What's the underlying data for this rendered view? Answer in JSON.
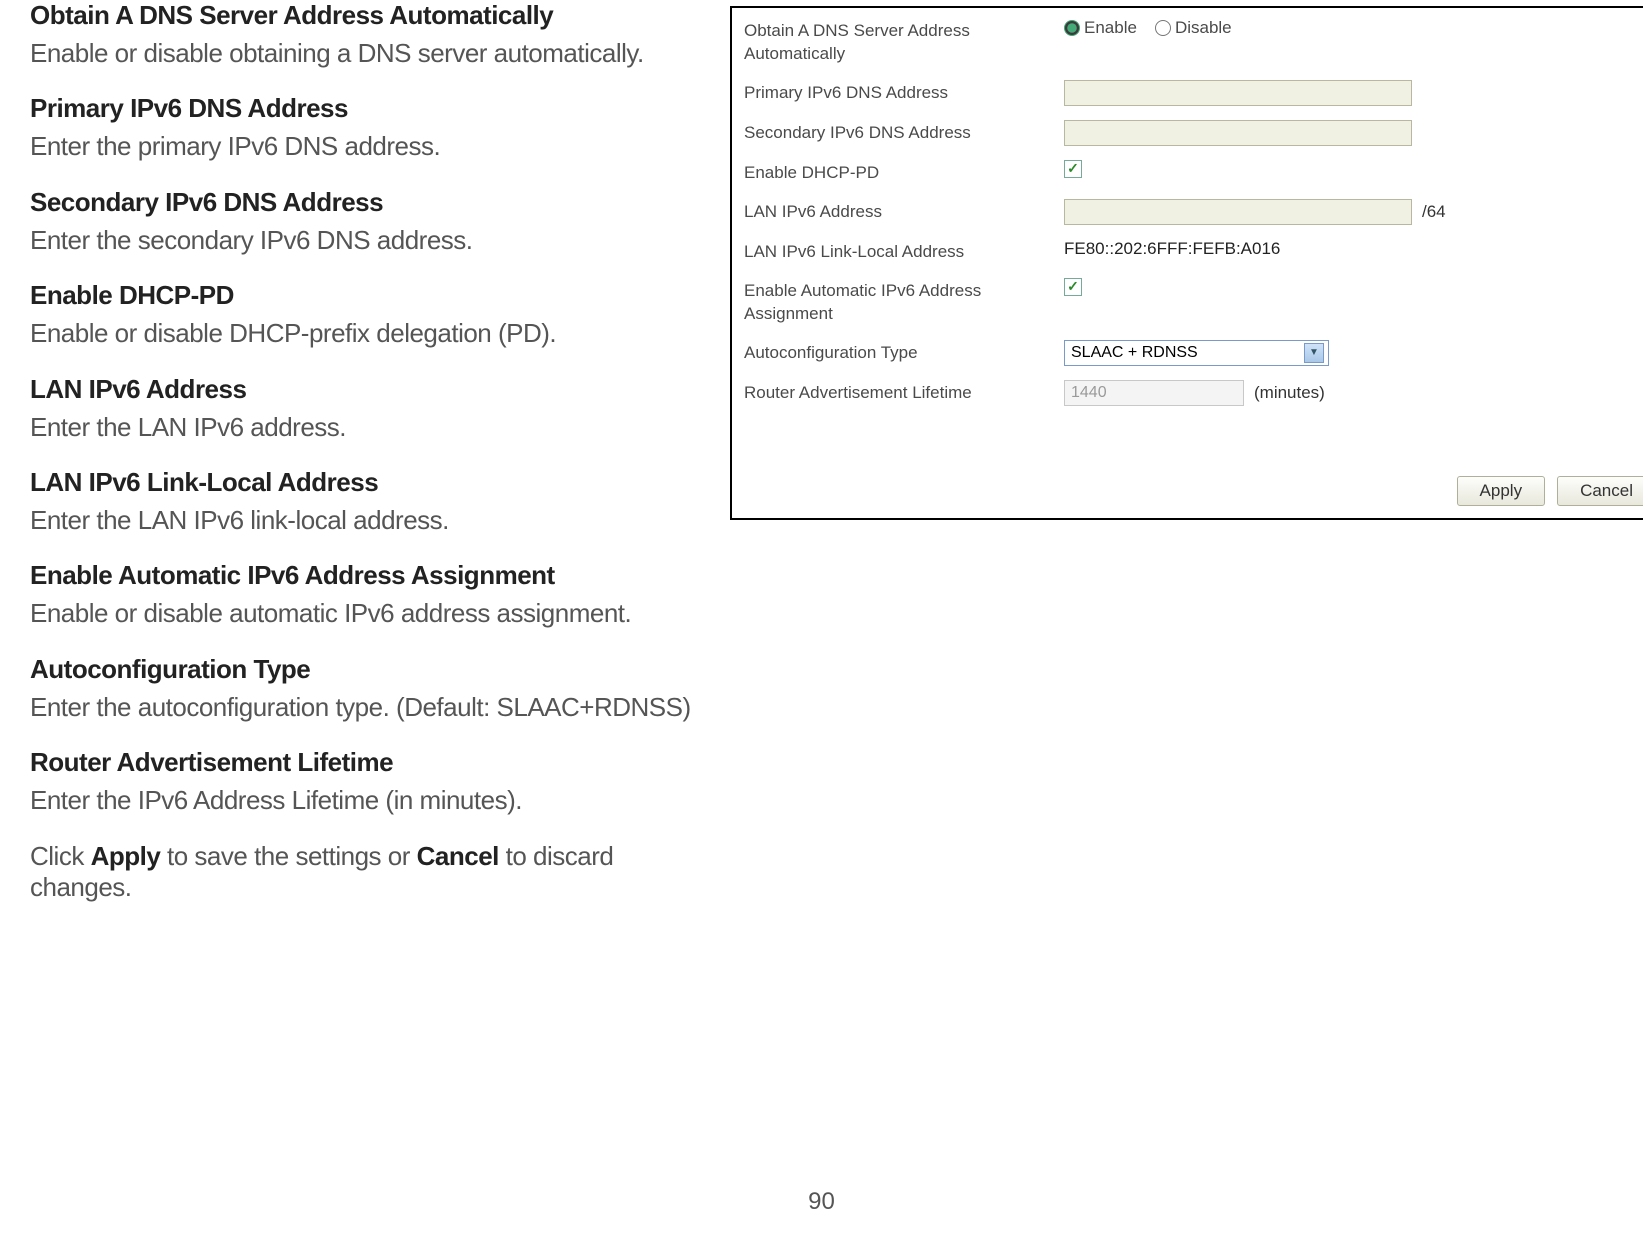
{
  "doc": {
    "items": [
      {
        "heading": "Obtain A DNS Server Address Automatically",
        "desc": "Enable or disable obtaining a DNS server automatically."
      },
      {
        "heading": "Primary IPv6 DNS Address",
        "desc": "Enter the primary IPv6 DNS address."
      },
      {
        "heading": "Secondary IPv6 DNS Address",
        "desc": "Enter the secondary IPv6 DNS address."
      },
      {
        "heading": "Enable DHCP-PD",
        "desc": "Enable or disable DHCP-prefix delegation (PD)."
      },
      {
        "heading": "LAN IPv6 Address",
        "desc": "Enter the LAN IPv6 address."
      },
      {
        "heading": "LAN IPv6 Link-Local Address",
        "desc": "Enter the LAN IPv6 link-local address."
      },
      {
        "heading": "Enable Automatic IPv6 Address Assignment",
        "desc": "Enable or disable automatic IPv6 address assignment."
      },
      {
        "heading": "Autoconfiguration Type",
        "desc": "Enter the autoconfiguration type. (Default: SLAAC+RDNSS)"
      },
      {
        "heading": "Router Advertisement Lifetime",
        "desc": "Enter the IPv6 Address Lifetime (in minutes)."
      }
    ],
    "final_pre": "Click ",
    "final_b1": "Apply",
    "final_mid": " to save the settings or ",
    "final_b2": "Cancel",
    "final_post": " to discard changes."
  },
  "form": {
    "labels": {
      "obtain": "Obtain A DNS Server Address Automatically",
      "primary": "Primary IPv6 DNS Address",
      "secondary": "Secondary IPv6 DNS Address",
      "dhcppd": "Enable DHCP-PD",
      "lan": "LAN IPv6 Address",
      "linklocal": "LAN IPv6 Link-Local Address",
      "autoassign": "Enable Automatic IPv6 Address Assignment",
      "autoconftype": "Autoconfiguration Type",
      "ralife": "Router Advertisement Lifetime"
    },
    "radio": {
      "enable": "Enable",
      "disable": "Disable",
      "selected": "enable"
    },
    "dhcppd_checked": "✓",
    "lan_suffix": "/64",
    "linklocal_value": "FE80::202:6FFF:FEFB:A016",
    "autoassign_checked": "✓",
    "autoconf_value": "SLAAC + RDNSS",
    "ralife_value": "1440",
    "ralife_unit": "(minutes)",
    "buttons": {
      "apply": "Apply",
      "cancel": "Cancel"
    }
  },
  "page_number": "90"
}
